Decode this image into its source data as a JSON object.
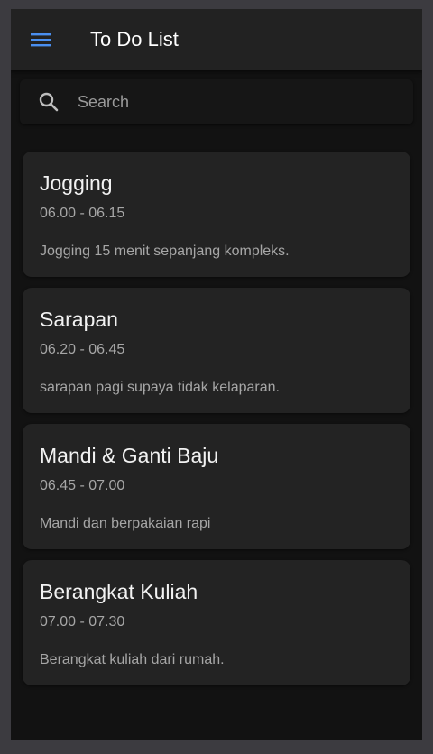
{
  "app": {
    "title": "To Do List",
    "accent_color": "#4a8ff0"
  },
  "toolbar": {
    "menu_icon": "hamburger-menu-icon"
  },
  "search": {
    "icon": "search-icon",
    "placeholder": "Search",
    "value": ""
  },
  "tasks": [
    {
      "title": "Jogging",
      "time": "06.00 - 06.15",
      "description": "Jogging 15 menit sepanjang kompleks."
    },
    {
      "title": "Sarapan",
      "time": "06.20 - 06.45",
      "description": "sarapan pagi supaya tidak kelaparan."
    },
    {
      "title": "Mandi & Ganti Baju",
      "time": "06.45 - 07.00",
      "description": "Mandi dan berpakaian rapi"
    },
    {
      "title": "Berangkat Kuliah",
      "time": "07.00 - 07.30",
      "description": "Berangkat kuliah dari rumah."
    }
  ]
}
